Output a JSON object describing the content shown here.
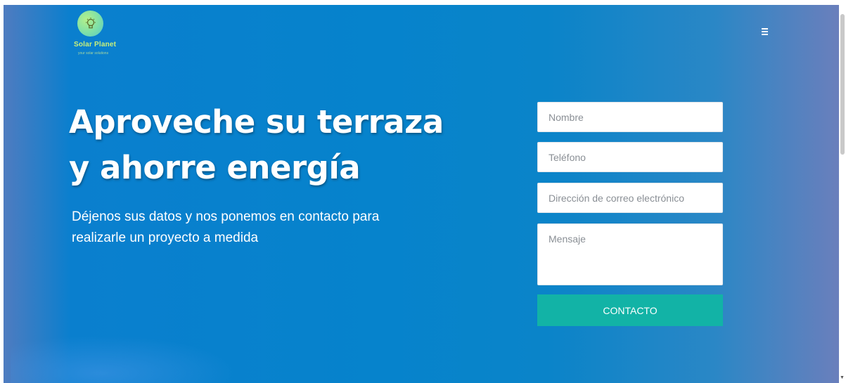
{
  "header": {
    "logo_name": "Solar Planet",
    "logo_tagline": "your solar solutions",
    "logo_icon": "lightbulb-icon",
    "menu_icon": "hamburger-menu-icon"
  },
  "hero": {
    "headline_line1": "Aproveche su terraza",
    "headline_line2": "y ahorre energía",
    "subline_line1": "Déjenos sus datos y nos ponemos en contacto para",
    "subline_line2": "realizarle un proyecto a medida"
  },
  "form": {
    "name_placeholder": "Nombre",
    "phone_placeholder": "Teléfono",
    "email_placeholder": "Dirección de correo electrónico",
    "message_placeholder": "Mensaje",
    "submit_label": "CONTACTO"
  },
  "colors": {
    "hero_blue": "#0683cc",
    "submit_teal": "#12b3a6",
    "logo_green": "#c9f07a"
  }
}
